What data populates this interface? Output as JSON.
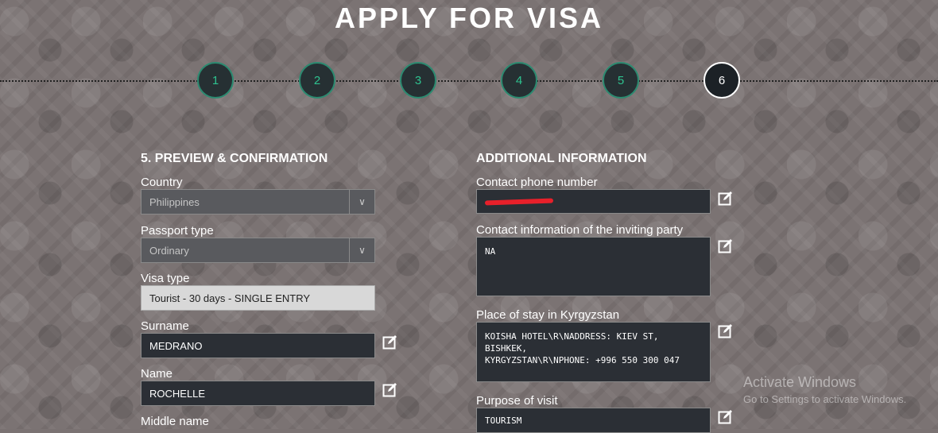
{
  "page": {
    "title": "APPLY FOR VISA"
  },
  "steps": [
    "1",
    "2",
    "3",
    "4",
    "5",
    "6"
  ],
  "active_step": "6",
  "left": {
    "section_title": "5. PREVIEW & CONFIRMATION",
    "country": {
      "label": "Country",
      "value": "Philippines"
    },
    "passport_type": {
      "label": "Passport type",
      "value": "Ordinary"
    },
    "visa_type": {
      "label": "Visa type",
      "value": "Tourist - 30 days - SINGLE ENTRY"
    },
    "surname": {
      "label": "Surname",
      "value": "MEDRANO"
    },
    "name": {
      "label": "Name",
      "value": "ROCHELLE"
    },
    "middle_name": {
      "label": "Middle name"
    }
  },
  "right": {
    "section_title": "ADDITIONAL INFORMATION",
    "phone": {
      "label": "Contact phone number"
    },
    "inviting_party": {
      "label": "Contact information of the inviting party",
      "value": "NA"
    },
    "place_of_stay": {
      "label": "Place of stay in Kyrgyzstan",
      "line1": "KOISHA HOTEL\\R\\NADDRESS: KIEV ST, BISHKEK,",
      "line2": "KYRGYZSTAN\\R\\NPHONE: +996 550 300 047"
    },
    "purpose": {
      "label": "Purpose of visit",
      "value": "TOURISM"
    }
  },
  "watermark": {
    "line1": "Activate Windows",
    "line2": "Go to Settings to activate Windows."
  },
  "icons": {
    "edit": "edit-icon",
    "chevron": "chevron-down-icon"
  }
}
